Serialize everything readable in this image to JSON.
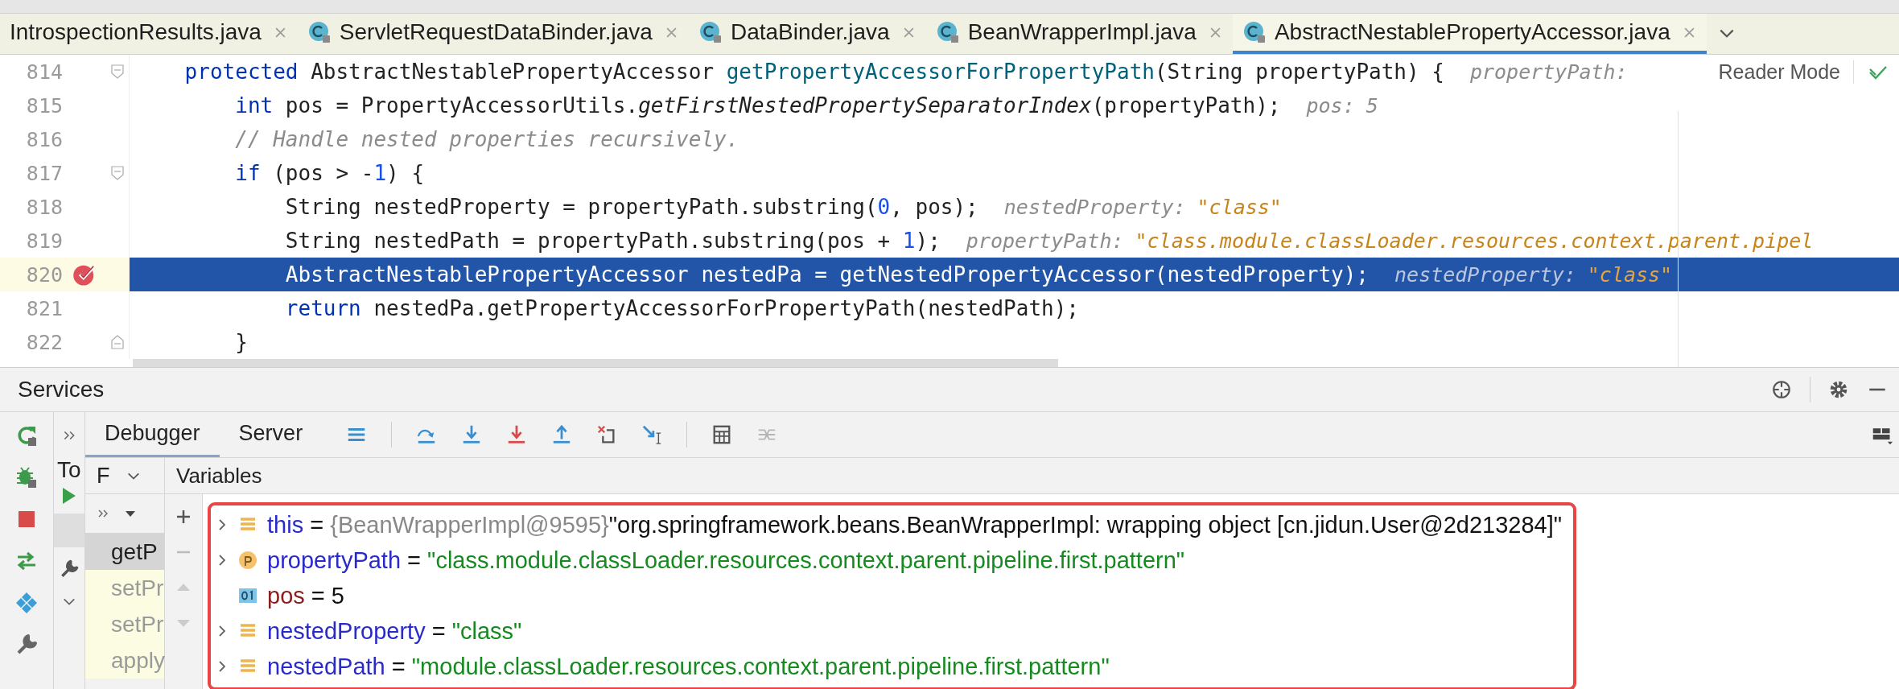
{
  "editor_tabs": [
    {
      "label": "IntrospectionResults.java",
      "has_icon": false,
      "selected": false
    },
    {
      "label": "ServletRequestDataBinder.java",
      "has_icon": true,
      "selected": false
    },
    {
      "label": "DataBinder.java",
      "has_icon": true,
      "selected": false
    },
    {
      "label": "BeanWrapperImpl.java",
      "has_icon": true,
      "selected": false
    },
    {
      "label": "AbstractNestablePropertyAccessor.java",
      "has_icon": true,
      "selected": true
    }
  ],
  "reader_mode": "Reader Mode",
  "code_lines": [
    {
      "number": "814",
      "fold_start": true,
      "fold_end": false,
      "breakpoint": false,
      "selected": false,
      "tokens": [
        {
          "t": "    protected",
          "kind": "keyword"
        },
        {
          "t": " AbstractNestablePropertyAccessor ",
          "kind": "plain"
        },
        {
          "t": "getPropertyAccessorForPropertyPath",
          "kind": "decl"
        },
        {
          "t": "(String propertyPath) {",
          "kind": "plain"
        }
      ],
      "hint": [
        {
          "t": "propertyPath:",
          "kind": "name"
        }
      ]
    },
    {
      "number": "815",
      "fold_start": false,
      "fold_end": false,
      "breakpoint": false,
      "selected": false,
      "tokens": [
        {
          "t": "        int",
          "kind": "keyword"
        },
        {
          "t": " pos = PropertyAccessorUtils.",
          "kind": "plain"
        },
        {
          "t": "getFirstNestedPropertySeparatorIndex",
          "kind": "static"
        },
        {
          "t": "(propertyPath);",
          "kind": "plain"
        }
      ],
      "hint": [
        {
          "t": "pos:",
          "kind": "name"
        },
        {
          "t": "5",
          "kind": "name"
        }
      ]
    },
    {
      "number": "816",
      "fold_start": false,
      "fold_end": false,
      "breakpoint": false,
      "selected": false,
      "tokens": [
        {
          "t": "        // Handle nested properties recursively.",
          "kind": "comment"
        }
      ]
    },
    {
      "number": "817",
      "fold_start": true,
      "fold_end": false,
      "breakpoint": false,
      "selected": false,
      "tokens": [
        {
          "t": "        if",
          "kind": "keyword"
        },
        {
          "t": " (pos > -",
          "kind": "plain"
        },
        {
          "t": "1",
          "kind": "number"
        },
        {
          "t": ") {",
          "kind": "plain"
        }
      ]
    },
    {
      "number": "818",
      "fold_start": false,
      "fold_end": false,
      "breakpoint": false,
      "selected": false,
      "tokens": [
        {
          "t": "            String nestedProperty = propertyPath.substring(",
          "kind": "plain"
        },
        {
          "t": "0",
          "kind": "number"
        },
        {
          "t": ", pos);",
          "kind": "plain"
        }
      ],
      "hint": [
        {
          "t": "nestedProperty:",
          "kind": "name"
        },
        {
          "t": "\"class\"",
          "kind": "string"
        }
      ]
    },
    {
      "number": "819",
      "fold_start": false,
      "fold_end": false,
      "breakpoint": false,
      "selected": false,
      "tokens": [
        {
          "t": "            String nestedPath = propertyPath.substring(pos + ",
          "kind": "plain"
        },
        {
          "t": "1",
          "kind": "number"
        },
        {
          "t": ");",
          "kind": "plain"
        }
      ],
      "hint": [
        {
          "t": "propertyPath:",
          "kind": "name"
        },
        {
          "t": "\"class.module.classLoader.resources.context.parent.pipel",
          "kind": "string"
        }
      ]
    },
    {
      "number": "820",
      "fold_start": false,
      "fold_end": false,
      "breakpoint": true,
      "selected": true,
      "tokens": [
        {
          "t": "            AbstractNestablePropertyAccessor nestedPa = getNestedPropertyAccessor(nestedProperty);",
          "kind": "plain"
        }
      ],
      "hint": [
        {
          "t": "nestedProperty:",
          "kind": "name"
        },
        {
          "t": "\"class\"",
          "kind": "string"
        }
      ]
    },
    {
      "number": "821",
      "fold_start": false,
      "fold_end": false,
      "breakpoint": false,
      "selected": false,
      "tokens": [
        {
          "t": "            return",
          "kind": "keyword"
        },
        {
          "t": " nestedPa.getPropertyAccessorForPropertyPath(nestedPath);",
          "kind": "plain"
        }
      ]
    },
    {
      "number": "822",
      "fold_start": false,
      "fold_end": true,
      "breakpoint": false,
      "selected": false,
      "tokens": [
        {
          "t": "        }",
          "kind": "plain"
        }
      ]
    }
  ],
  "services": {
    "title": "Services",
    "side_label": "To",
    "debugger_tabs": [
      {
        "label": "Debugger",
        "selected": true
      },
      {
        "label": "Server",
        "selected": false
      }
    ],
    "frames_header": "F",
    "frames": [
      {
        "label": "getP",
        "selected": true
      },
      {
        "label": "setPr",
        "selected": false
      },
      {
        "label": "setPr",
        "selected": false
      },
      {
        "label": "apply",
        "selected": false
      }
    ],
    "variables_header": "Variables",
    "variables": [
      {
        "name": "this",
        "kind": "object",
        "expandable": true,
        "operator": "=",
        "type_hint": "{BeanWrapperImpl@9595}",
        "value": "\"org.springframework.beans.BeanWrapperImpl: wrapping object [cn.jidun.User@2d213284]\"",
        "is_string": false
      },
      {
        "name": "propertyPath",
        "kind": "param",
        "expandable": true,
        "operator": "=",
        "value": "\"class.module.classLoader.resources.context.parent.pipeline.first.pattern\"",
        "is_string": true
      },
      {
        "name": "pos",
        "kind": "primitive",
        "expandable": false,
        "operator": "=",
        "value": "5",
        "is_string": false
      },
      {
        "name": "nestedProperty",
        "kind": "object",
        "expandable": true,
        "operator": "=",
        "value": "\"class\"",
        "is_string": true
      },
      {
        "name": "nestedPath",
        "kind": "object",
        "expandable": true,
        "operator": "=",
        "value": "\"module.classLoader.resources.context.parent.pipeline.first.pattern\"",
        "is_string": true
      }
    ]
  }
}
